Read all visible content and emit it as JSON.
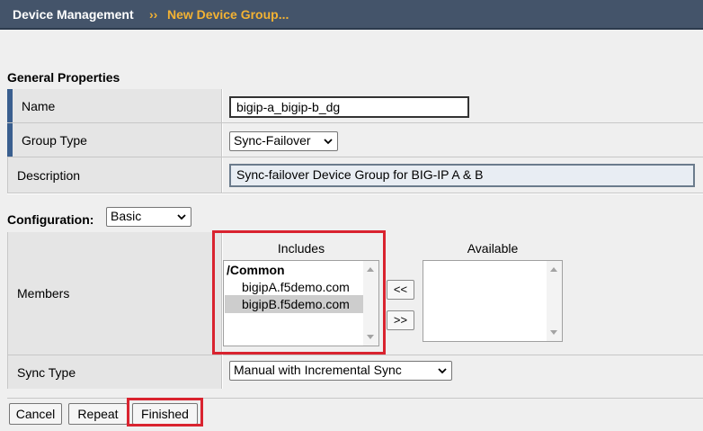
{
  "breadcrumb": {
    "parent": "Device Management",
    "separator": "››",
    "current": "New Device Group..."
  },
  "general": {
    "heading": "General Properties",
    "name_label": "Name",
    "name_value": "bigip-a_bigip-b_dg",
    "group_type_label": "Group Type",
    "group_type_value": "Sync-Failover",
    "description_label": "Description",
    "description_value": "Sync-failover Device Group for BIG-IP A & B"
  },
  "configuration": {
    "label": "Configuration:",
    "mode_value": "Basic",
    "members_label": "Members",
    "includes_title": "Includes",
    "available_title": "Available",
    "includes_group": "/Common",
    "includes_items": [
      "bigipA.f5demo.com",
      "bigipB.f5demo.com"
    ],
    "selected_item": "bigipB.f5demo.com",
    "move_left_label": "<<",
    "move_right_label": ">>",
    "sync_type_label": "Sync Type",
    "sync_type_value": "Manual with Incremental Sync"
  },
  "actions": {
    "cancel": "Cancel",
    "repeat": "Repeat",
    "finished": "Finished"
  },
  "colors": {
    "titlebar": "#44546a",
    "breadcrumb_accent": "#f3b233",
    "required_marker": "#3a5f8f",
    "highlight": "#d9232f"
  }
}
